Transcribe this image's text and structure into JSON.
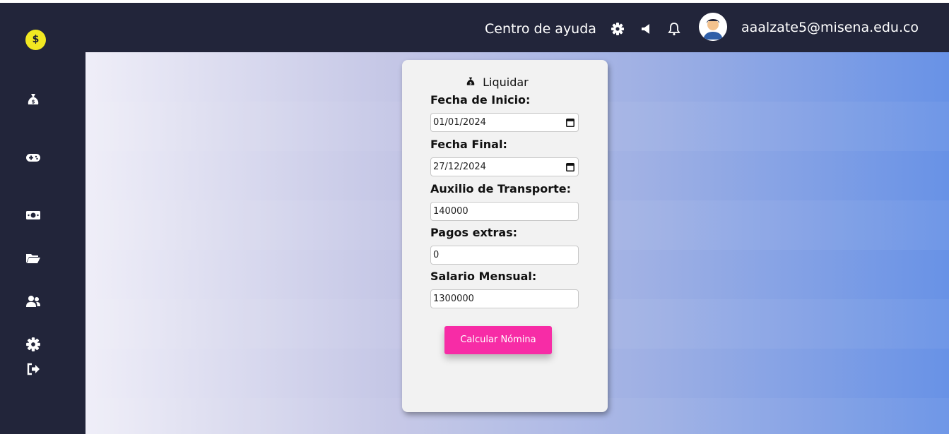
{
  "topbar": {
    "help_label": "Centro de ayuda",
    "icons": [
      "gear-icon",
      "megaphone-icon",
      "bell-icon"
    ],
    "user_email": "aaalzate5@misena.edu.co"
  },
  "sidebar": {
    "logo_symbol": "$",
    "items": [
      "money-bag-icon",
      "gamepad-icon",
      "money-bill-icon",
      "folder-open-icon",
      "users-icon",
      "settings-icon",
      "logout-icon"
    ]
  },
  "form": {
    "title": "Liquidar",
    "start_date_label": "Fecha de Inicio:",
    "start_date_value": "01/01/2024",
    "end_date_label": "Fecha Final:",
    "end_date_value": "27/12/2024",
    "transport_label": "Auxilio de Transporte:",
    "transport_value": "140000",
    "extra_label": "Pagos extras:",
    "extra_value": "0",
    "salary_label": "Salario Mensual:",
    "salary_value": "1300000",
    "submit_label": "Calcular Nómina"
  },
  "colors": {
    "sidebar_bg": "#22253a",
    "logo_bg": "#f1e822",
    "button_bg": "#f72ca6",
    "gradient_start": "#efeef8",
    "gradient_end": "#6892e6"
  }
}
